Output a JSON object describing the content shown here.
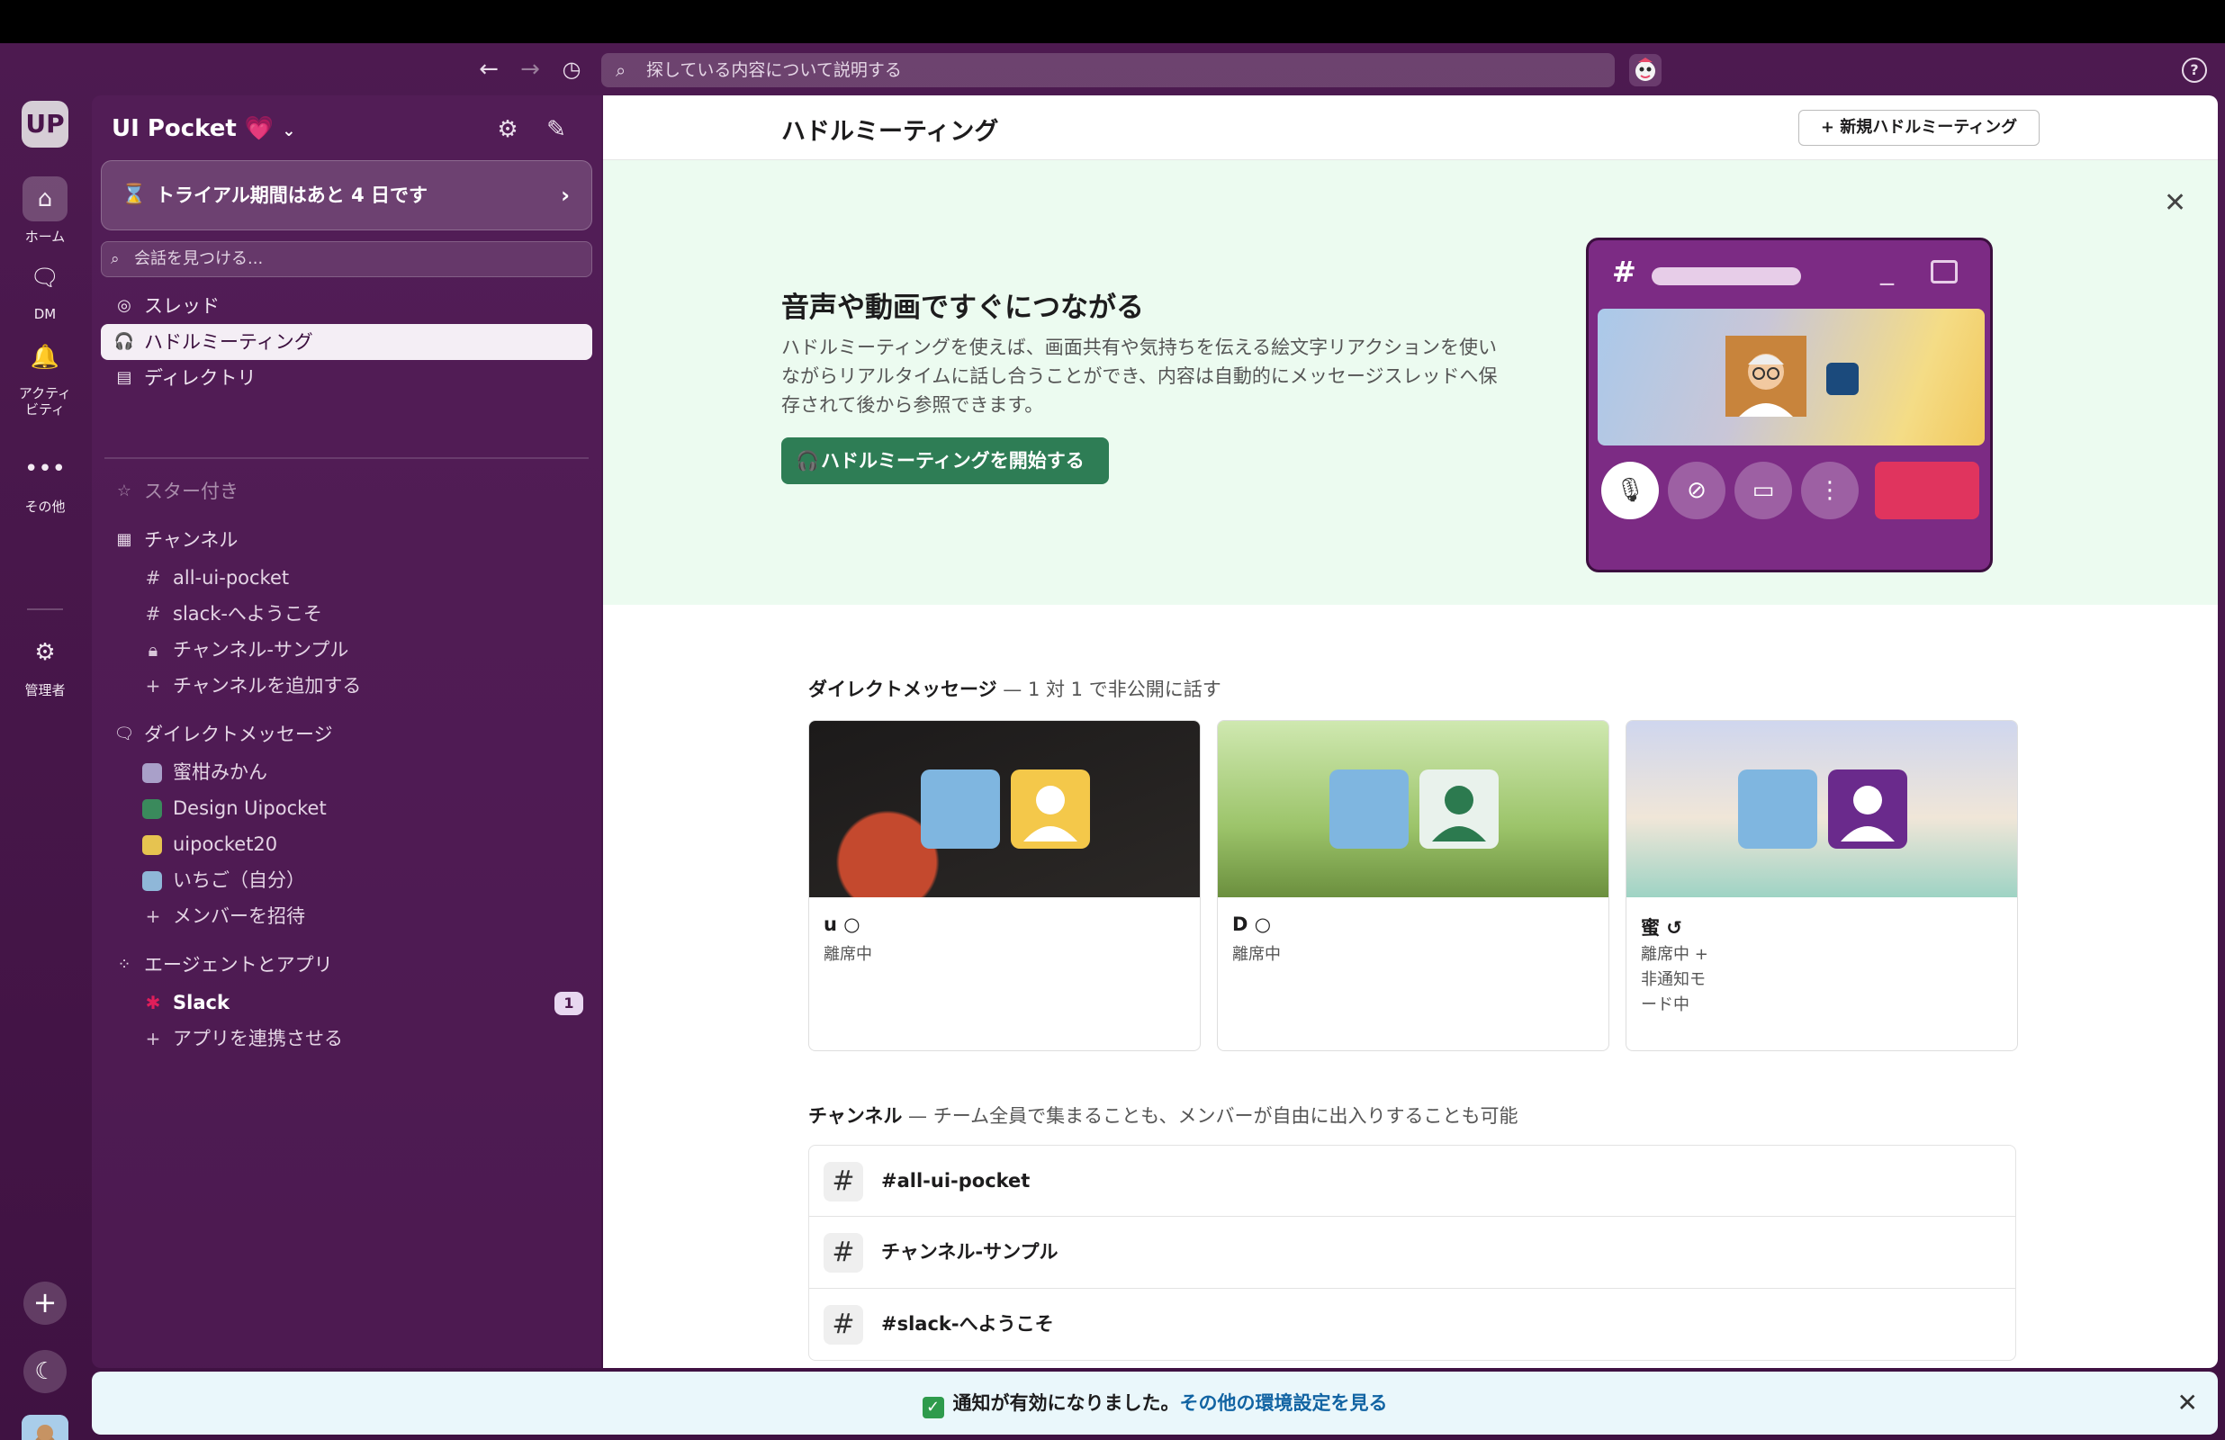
{
  "search": {
    "placeholder": "探している内容について説明する"
  },
  "rail": {
    "workspace_initials": "UP",
    "items": [
      {
        "label": "ホーム",
        "icon": "home-icon"
      },
      {
        "label": "DM",
        "icon": "dm-icon"
      },
      {
        "label": "アクティビティ",
        "icon": "bell-icon"
      },
      {
        "label": "その他",
        "icon": "more-icon"
      },
      {
        "label": "管理者",
        "icon": "gear-icon"
      }
    ]
  },
  "sidebar": {
    "workspace_name": "UI Pocket 💗",
    "trial": "トライアル期間はあと 4 日です",
    "find_placeholder": "会話を見つける...",
    "nav": [
      {
        "label": "スレッド"
      },
      {
        "label": "ハドルミーティング"
      },
      {
        "label": "ディレクトリ"
      }
    ],
    "starred": "スター付き",
    "channels_header": "チャンネル",
    "channels": [
      "all-ui-pocket",
      "slack-へようこそ",
      "チャンネル-サンプル",
      "チャンネルを追加する"
    ],
    "dm_header": "ダイレクトメッセージ",
    "dms": [
      "蜜柑みかん",
      "Design Uipocket",
      "uipocket20",
      "いちご（自分）",
      "メンバーを招待"
    ],
    "apps_header": "エージェントとアプリ",
    "apps": [
      {
        "label": "Slack",
        "badge": "1"
      },
      {
        "label": "アプリを連携させる"
      }
    ]
  },
  "main": {
    "title": "ハドルミーティング",
    "new_button": "+ 新規ハドルミーティング",
    "hero": {
      "title": "音声や動画ですぐにつながる",
      "body": "ハドルミーティングを使えば、画面共有や気持ちを伝える絵文字リアクションを使いながらリアルタイムに話し合うことができ、内容は自動的にメッセージスレッドへ保存されて後から参照できます。",
      "button": "ハドルミーティングを開始する"
    },
    "dm_section": {
      "title": "ダイレクトメッセージ",
      "subtitle": " — 1 対 1 で非公開に話す"
    },
    "cards": [
      {
        "name": "u ○",
        "status": "離席中"
      },
      {
        "name": "D ○",
        "status": "離席中"
      },
      {
        "name": "蜜 ↺",
        "status": "離席中 + 非通知モード中"
      }
    ],
    "channel_section": {
      "title": "チャンネル",
      "subtitle": " — チーム全員で集まることも、メンバーが自由に出入りすることも可能"
    },
    "channels": [
      "#all-ui-pocket",
      "チャンネル-サンプル",
      "#slack-へようこそ"
    ]
  },
  "toast": {
    "message": "通知が有効になりました。",
    "link": "その他の環境設定を見る"
  }
}
